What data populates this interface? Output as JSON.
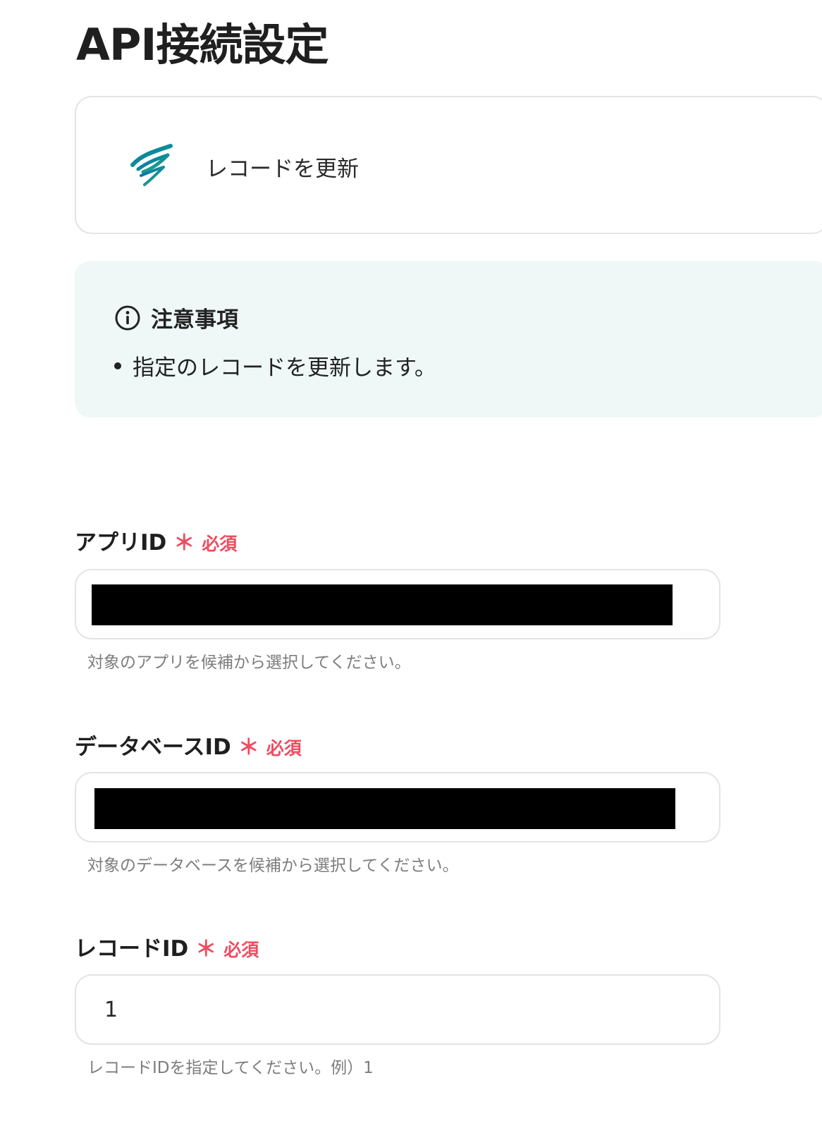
{
  "page": {
    "title": "API接続設定"
  },
  "action_card": {
    "logo_icon": "app-wave-logo-icon",
    "action_name": "レコードを更新"
  },
  "notice": {
    "icon": "info-icon",
    "title": "注意事項",
    "items": [
      "指定のレコードを更新します。"
    ]
  },
  "form": {
    "required_mark": "＊",
    "required_label": "必須",
    "fields": [
      {
        "label": "アプリID",
        "value": "",
        "redacted": true,
        "help": "対象のアプリを候補から選択してください。"
      },
      {
        "label": "データベースID",
        "value": "",
        "redacted": true,
        "help": "対象のデータベースを候補から選択してください。"
      },
      {
        "label": "レコードID",
        "value": "1",
        "redacted": false,
        "help": "レコードIDを指定してください。例）1"
      }
    ]
  },
  "colors": {
    "required": "#ef4b5f",
    "notice_background": "#eff7f7",
    "border": "#e2e4e7",
    "logo_teal": "#0c8f9a",
    "logo_blue": "#0d5cab",
    "logo_green": "#58b86a"
  }
}
